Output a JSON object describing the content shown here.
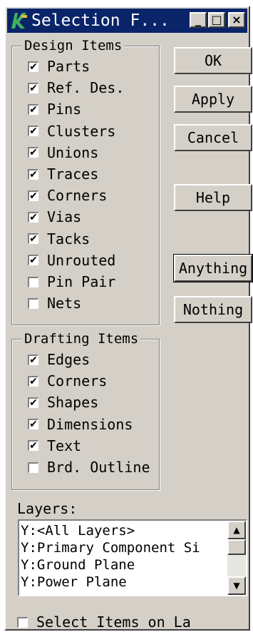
{
  "window": {
    "title": "Selection F...",
    "minimize": "_",
    "maximize": "□",
    "close": "×"
  },
  "design_items": {
    "legend": "Design Items",
    "items": [
      {
        "label": "Parts",
        "checked": true
      },
      {
        "label": "Ref. Des.",
        "checked": true
      },
      {
        "label": "Pins",
        "checked": true
      },
      {
        "label": "Clusters",
        "checked": true
      },
      {
        "label": "Unions",
        "checked": true
      },
      {
        "label": "Traces",
        "checked": true
      },
      {
        "label": "Corners",
        "checked": true
      },
      {
        "label": "Vias",
        "checked": true
      },
      {
        "label": "Tacks",
        "checked": true
      },
      {
        "label": "Unrouted",
        "checked": true
      },
      {
        "label": "Pin Pair",
        "checked": false
      },
      {
        "label": "Nets",
        "checked": false
      }
    ]
  },
  "drafting_items": {
    "legend": "Drafting Items",
    "items": [
      {
        "label": "Edges",
        "checked": true
      },
      {
        "label": "Corners",
        "checked": true
      },
      {
        "label": "Shapes",
        "checked": true
      },
      {
        "label": "Dimensions",
        "checked": true
      },
      {
        "label": "Text",
        "checked": true
      },
      {
        "label": "Brd. Outline",
        "checked": false
      }
    ]
  },
  "buttons": {
    "ok": "OK",
    "apply": "Apply",
    "cancel": "Cancel",
    "help": "Help",
    "anything": "Anything",
    "nothing": "Nothing"
  },
  "layers": {
    "label": "Layers:",
    "items": [
      "Y:<All Layers>",
      "Y:Primary Component Si",
      "Y:Ground Plane",
      "Y:Power Plane"
    ]
  },
  "select_items_on_layer": {
    "label": "Select Items on La",
    "checked": false
  },
  "icons": {
    "app": "app-icon",
    "check": "✔",
    "scroll_up": "▲",
    "scroll_down": "▼"
  },
  "colors": {
    "titlebar": "#0a246a",
    "face": "#d4d0c8"
  }
}
